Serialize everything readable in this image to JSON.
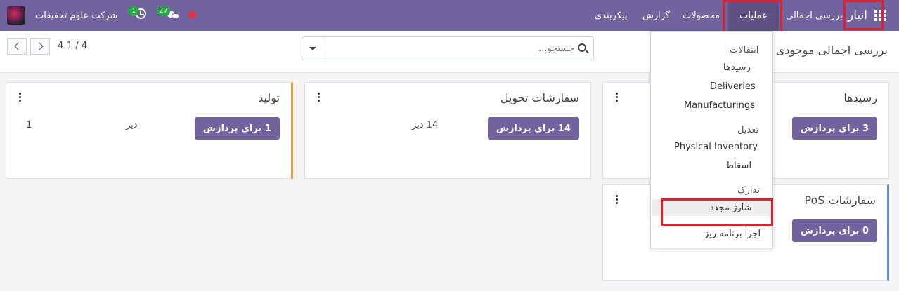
{
  "navbar": {
    "brand": "انبار",
    "menu": [
      "بررسی اجمالی",
      "عملیات",
      "محصولات",
      "گزارش",
      "پیکربندی"
    ],
    "chat_count": "27",
    "activity_count": "1",
    "company": "شرکت علوم تحقیقات",
    "colors": {
      "bar": "#71639e",
      "active": "#5e5282",
      "highlight_box": "#e0202d"
    }
  },
  "control": {
    "title": "بررسی اجمالی موجودی",
    "search_placeholder": "جستجو...",
    "pager": "4-1 / 4"
  },
  "cards": {
    "receipts": {
      "title": "رسیدها",
      "button": "3 برای پردازش"
    },
    "deliveries": {
      "title": "سفارشات تحویل",
      "button": "14 برای پردازش",
      "late": "14 دیر"
    },
    "manufacturing": {
      "title": "تولید",
      "button": "1 برای پردازش",
      "late": "دیر",
      "late_count": "1"
    },
    "pos": {
      "title": "سفارشات PoS",
      "button": "0 برای پردازش"
    }
  },
  "dropdown": {
    "transfers_header": "انتقالات",
    "receipts": "رسیدها",
    "deliveries": "Deliveries",
    "manufacturings": "Manufacturings",
    "adjustments_header": "تعدیل",
    "physical_inventory": "Physical Inventory",
    "scrap": "اسقاط",
    "procurement_header": "تدارک",
    "replenishment": "شارژ مجدد",
    "run_scheduler": "اجرا برنامه ریز"
  }
}
